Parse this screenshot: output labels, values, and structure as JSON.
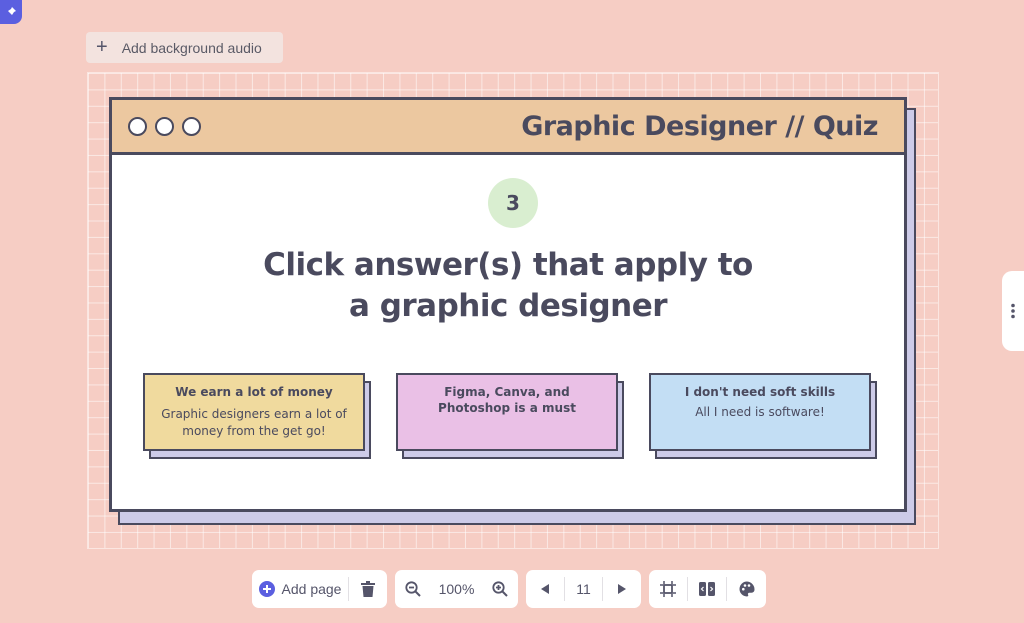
{
  "toolbar_top": {
    "audio_label": "Add background audio"
  },
  "slide": {
    "title": "Graphic Designer // Quiz",
    "number": "3",
    "question_line1": "Click answer(s) that apply to",
    "question_line2": "a graphic designer",
    "answers": [
      {
        "head": "We earn a lot of money",
        "body": "Graphic designers earn a lot of money from the get go!",
        "color": "#f0da9e"
      },
      {
        "head": "Figma, Canva, and Photoshop is a must",
        "body": "",
        "color": "#eac0e6"
      },
      {
        "head": "I don't need soft skills",
        "body": "All I need is software!",
        "color": "#c3def4"
      }
    ]
  },
  "bottom_toolbar": {
    "add_page_label": "Add page",
    "zoom_value": "100%",
    "page_number": "11"
  },
  "colors": {
    "accent": "#5b5fe0",
    "background": "#f6cdc4",
    "ink": "#4a4a5e"
  }
}
